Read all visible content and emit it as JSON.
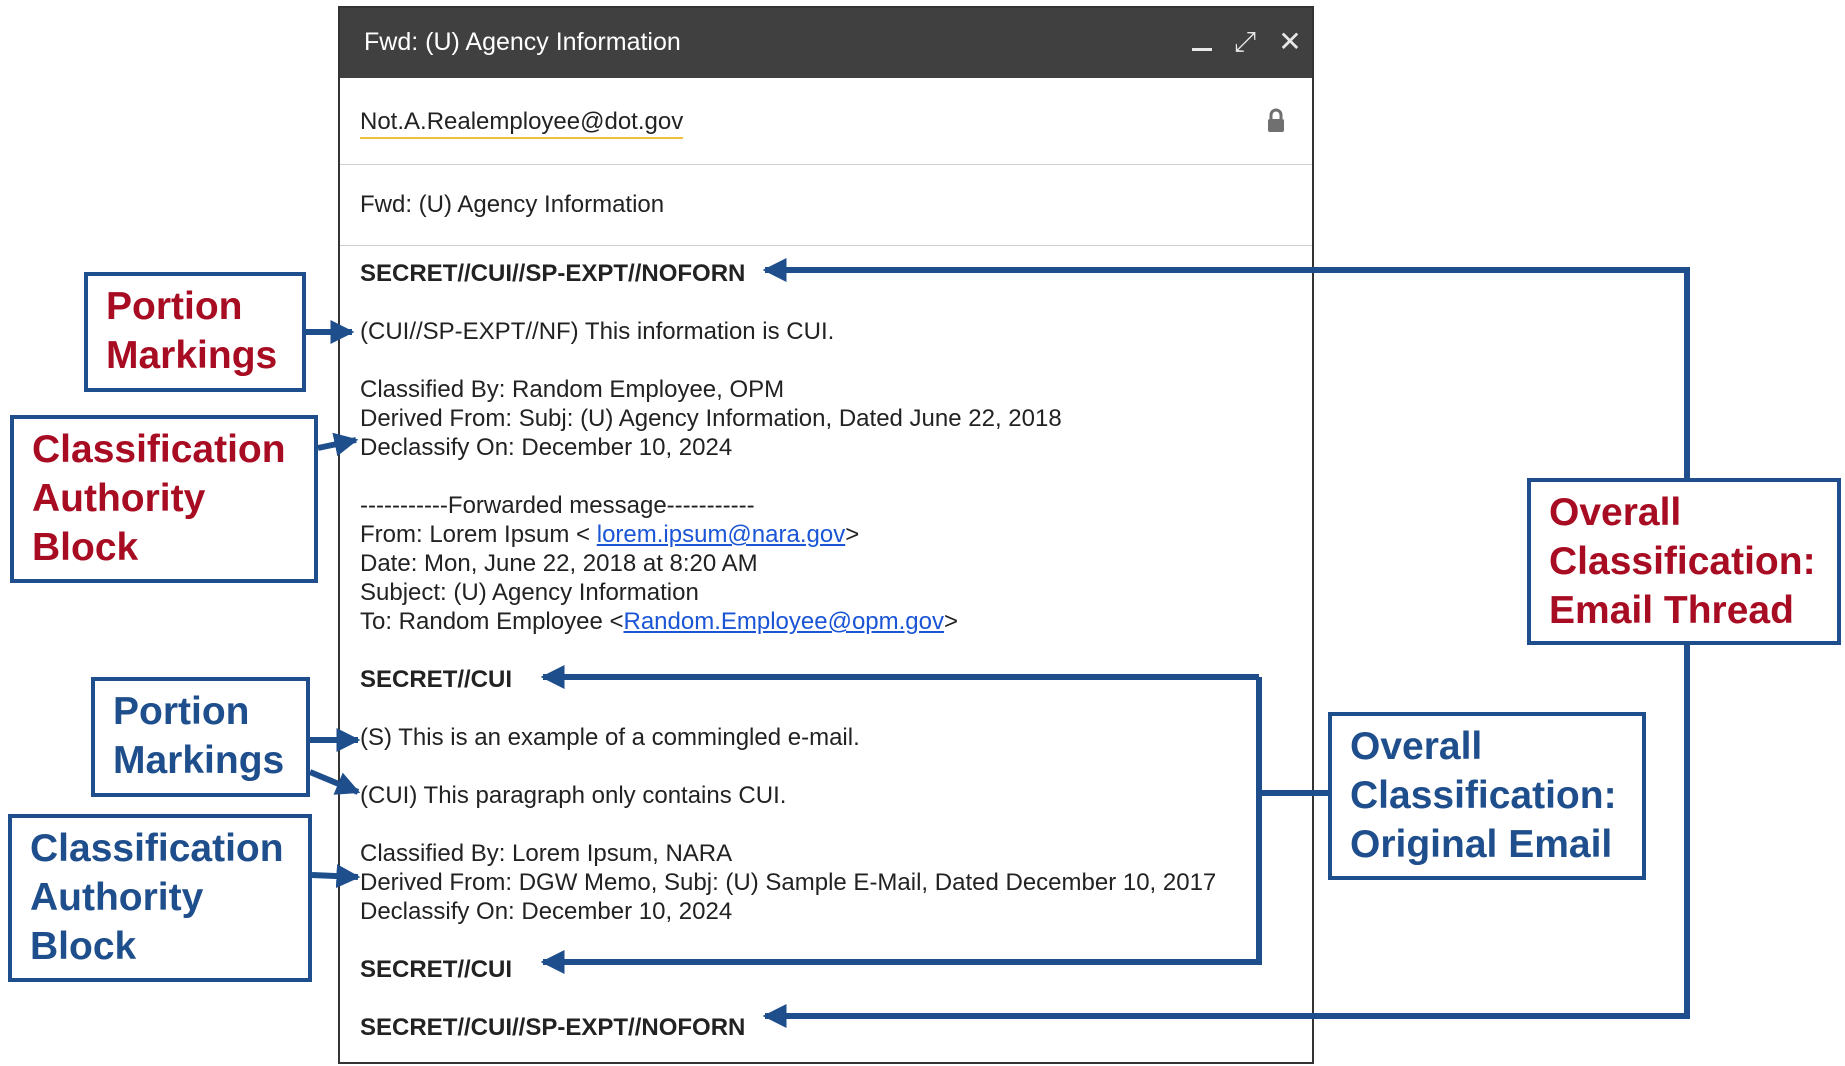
{
  "window": {
    "title": "Fwd: (U) Agency Information",
    "to": "Not.A.Realemployee@dot.gov",
    "subject": "Fwd: (U) Agency Information"
  },
  "body": {
    "header_marking": "SECRET//CUI//SP-EXPT//NOFORN",
    "portion_1": "(CUI//SP-EXPT//NF) This information is CUI.",
    "classified_by": "Classified By: Random Employee, OPM",
    "derived_from": "Derived From: Subj: (U) Agency Information, Dated June 22, 2018",
    "declassify_on": "Declassify On: December 10, 2024",
    "forwarded": "-----------Forwarded message-----------",
    "from_prefix": "From: Lorem Ipsum < ",
    "from_email": "lorem.ipsum@nara.gov",
    "from_suffix": ">",
    "date": "Date: Mon, June 22, 2018 at 8:20 AM",
    "subject": "Subject: (U) Agency Information",
    "to_prefix": "To: Random Employee <",
    "to_email": "Random.Employee@opm.gov",
    "to_suffix": ">",
    "orig_marking_top": "SECRET//CUI",
    "portion_s": "(S) This is an example of a commingled e-mail.",
    "portion_cui": "(CUI) This paragraph only contains CUI.",
    "orig_classified_by": "Classified By: Lorem Ipsum, NARA",
    "orig_derived_from": "Derived From: DGW Memo, Subj: (U) Sample E-Mail, Dated December 10, 2017",
    "orig_declassify_on": "Declassify On: December 10, 2024",
    "orig_marking_bottom": "SECRET//CUI",
    "footer_marking": "SECRET//CUI//SP-EXPT//NOFORN"
  },
  "callouts": {
    "portion_markings_1": [
      "Portion",
      "Markings"
    ],
    "authority_block_1": [
      "Classification",
      "Authority",
      "Block"
    ],
    "portion_markings_2": [
      "Portion",
      "Markings"
    ],
    "authority_block_2": [
      "Classification",
      "Authority",
      "Block"
    ],
    "overall_thread": [
      "Overall",
      "Classification:",
      "Email Thread"
    ],
    "overall_original": [
      "Overall",
      "Classification:",
      "Original Email"
    ]
  },
  "colors": {
    "callout_border": "#1f4e8c",
    "callout_red": "#a80c22",
    "callout_blue": "#1f4e8c",
    "titlebar": "#404040"
  },
  "icons": [
    "minimize-icon",
    "expand-icon",
    "close-icon",
    "lock-icon"
  ]
}
